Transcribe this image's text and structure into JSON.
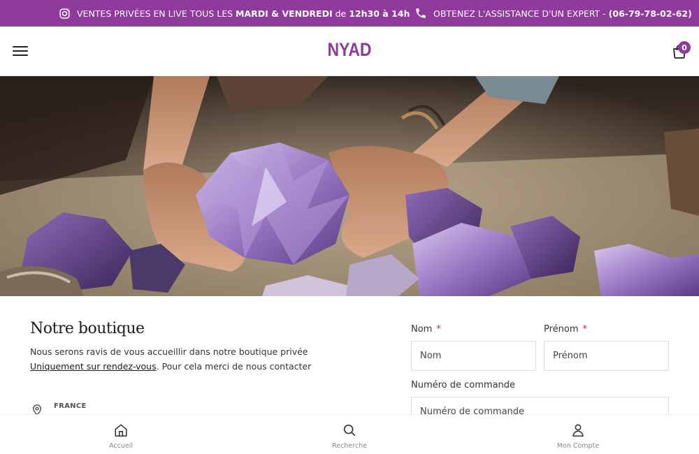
{
  "topbar": {
    "promo_pre": "VENTES PRIVÉES EN LIVE TOUS LES ",
    "promo_days": "MARDI & VENDREDI",
    "promo_mid": " de ",
    "promo_hours": "12h30 à 14h",
    "assist_pre": "OBTENEZ L'ASSISTANCE D'UN EXPERT - ",
    "assist_phone": "(06-79-78-02-62)",
    "promo_icon": "instagram-icon",
    "assist_icon": "phone-icon"
  },
  "header": {
    "logo": "NYAD",
    "cart_count": "0",
    "menu_icon": "hamburger-icon",
    "cart_icon": "shopping-bag-icon"
  },
  "hero": {
    "subject": "hands holding amethyst crystal clusters"
  },
  "shop": {
    "title": "Notre boutique",
    "desc_pre": "Nous serons ravis de vous accueillir dans notre boutique privée ",
    "desc_link": "Uniquement sur rendez-vous",
    "desc_post": ". Pour cela merci de nous contacter",
    "country": "FRANCE"
  },
  "form": {
    "nom_label": "Nom",
    "nom_placeholder": "Nom",
    "prenom_label": "Prénom",
    "prenom_placeholder": "Prénom",
    "required_mark": "*",
    "commande_label": "Numéro de commande",
    "commande_placeholder": "Numéro de commande"
  },
  "bottomnav": {
    "items": [
      {
        "label": "Accueil",
        "icon": "home-icon"
      },
      {
        "label": "Recherche",
        "icon": "search-icon"
      },
      {
        "label": "Mon Compte",
        "icon": "user-icon"
      }
    ]
  },
  "colors": {
    "brand": "#8e3b9b",
    "required": "#d0263f"
  }
}
